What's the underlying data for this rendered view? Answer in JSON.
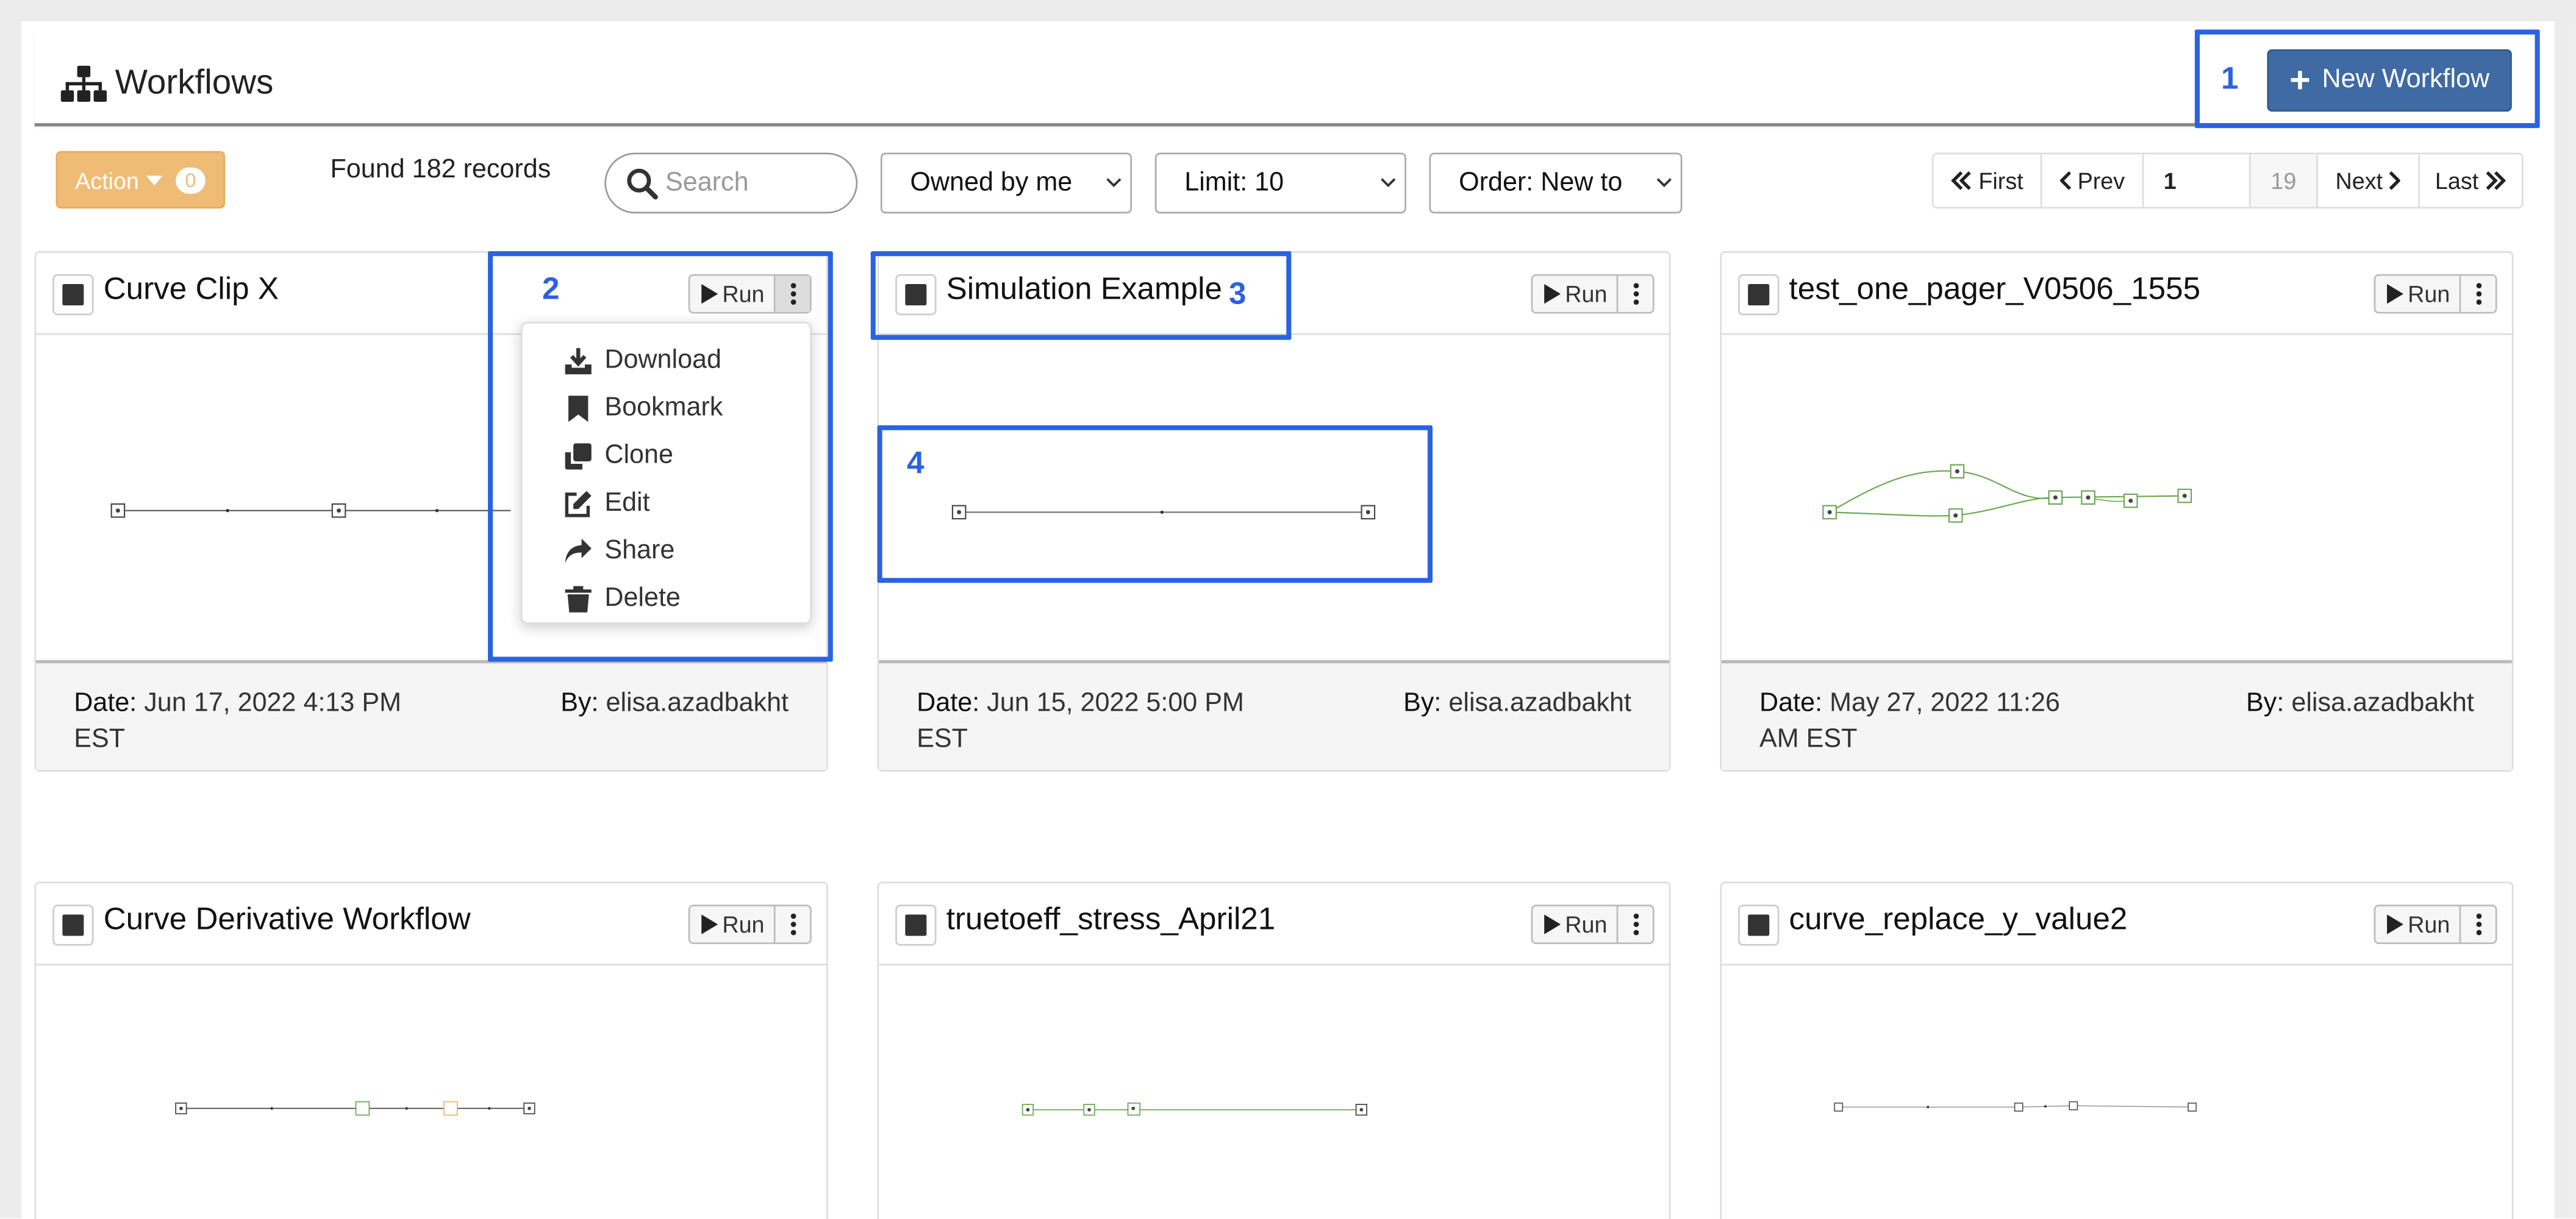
{
  "header": {
    "title": "Workflows",
    "new_workflow_label": "New Workflow"
  },
  "toolbar": {
    "action_label": "Action",
    "action_count": "0",
    "found_text": "Found 182 records",
    "search_placeholder": "Search",
    "owner_filter": "Owned by me",
    "limit": "Limit: 10",
    "order": "Order: New to Old"
  },
  "pager": {
    "first": "First",
    "prev": "Prev",
    "page": "1",
    "total_pages": "19",
    "next": "Next",
    "last": "Last"
  },
  "annotations": [
    "1",
    "2",
    "3",
    "4"
  ],
  "cards": [
    {
      "title": "Curve Clip X",
      "date_label": "Date:",
      "date": "Jun 17, 2022 4:13 PM EST",
      "by_label": "By:",
      "author": "elisa.azadbakht",
      "run_label": "Run"
    },
    {
      "title": "Simulation Example",
      "date_label": "Date:",
      "date": "Jun 15, 2022 5:00 PM EST",
      "by_label": "By:",
      "author": "elisa.azadbakht",
      "run_label": "Run"
    },
    {
      "title": "test_one_pager_V0506_1555",
      "date_label": "Date:",
      "date": "May 27, 2022 11:26 AM EST",
      "by_label": "By:",
      "author": "elisa.azadbakht",
      "run_label": "Run"
    },
    {
      "title": "Curve Derivative Workflow",
      "run_label": "Run"
    },
    {
      "title": "truetoeff_stress_April21",
      "run_label": "Run"
    },
    {
      "title": "curve_replace_y_value2",
      "run_label": "Run"
    }
  ],
  "menu": {
    "items": [
      "Download",
      "Bookmark",
      "Clone",
      "Edit",
      "Share",
      "Delete"
    ]
  },
  "colors": {
    "primary": "#3f6aa3",
    "action": "#efbc76",
    "annotation": "#2a62e0",
    "node_green": "#6aa84f",
    "node_orange": "#f0b36a"
  }
}
